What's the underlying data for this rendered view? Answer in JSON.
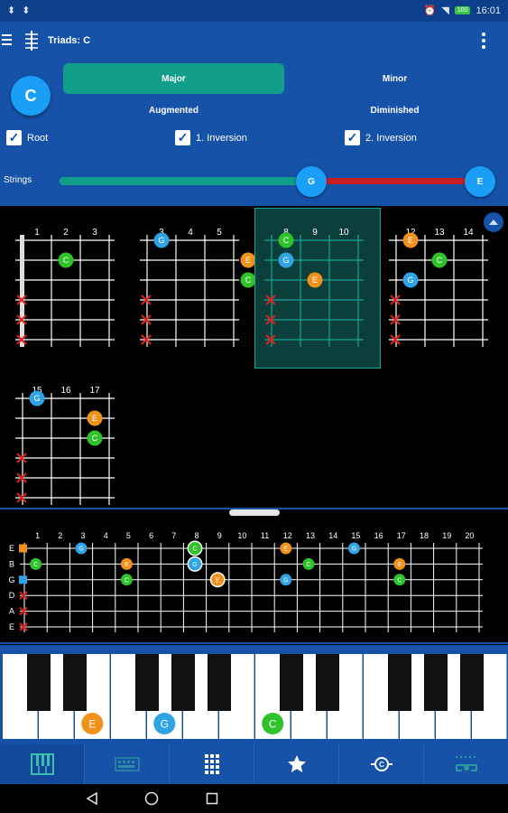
{
  "status": {
    "left_icons": "⬍ ⬍",
    "time": "16:01",
    "battery": "100"
  },
  "app": {
    "title": "Triads: C"
  },
  "root": {
    "note": "C"
  },
  "qualities": {
    "major": "Major",
    "minor": "Minor",
    "augmented": "Augmented",
    "diminished": "Diminished",
    "selected": "Major"
  },
  "inversions": [
    {
      "label": "Root",
      "checked": true
    },
    {
      "label": "1. Inversion",
      "checked": true
    },
    {
      "label": "2. Inversion",
      "checked": true
    }
  ],
  "strings": {
    "label": "Strings",
    "from": "G",
    "to": "E"
  },
  "colors": {
    "C": "#2ec22b",
    "E": "#f0911c",
    "G": "#2ea3e6",
    "accent": "#1552a8",
    "teal": "#119e8b",
    "red": "#c81d24",
    "mute": "#e0201c"
  },
  "chord_diagrams": [
    {
      "frets": [
        "1",
        "2",
        "3"
      ],
      "notes": [
        {
          "s": 1,
          "f": 2,
          "n": "C"
        }
      ],
      "muted": [
        3,
        4,
        5
      ],
      "nut": true,
      "selected": false
    },
    {
      "frets": [
        "3",
        "4",
        "5"
      ],
      "notes": [
        {
          "s": 0,
          "f": 1,
          "n": "G"
        },
        {
          "s": 1,
          "f": 4,
          "n": "E"
        },
        {
          "s": 2,
          "f": 4,
          "n": "C"
        }
      ],
      "muted": [
        3,
        4,
        5
      ],
      "nut": false,
      "selected": false
    },
    {
      "frets": [
        "8",
        "9",
        "10"
      ],
      "notes": [
        {
          "s": 0,
          "f": 1,
          "n": "C"
        },
        {
          "s": 1,
          "f": 1,
          "n": "G"
        },
        {
          "s": 2,
          "f": 2,
          "n": "E"
        }
      ],
      "muted": [
        3,
        4,
        5
      ],
      "nut": false,
      "selected": true
    },
    {
      "frets": [
        "12",
        "13",
        "14"
      ],
      "notes": [
        {
          "s": 0,
          "f": 1,
          "n": "E"
        },
        {
          "s": 1,
          "f": 2,
          "n": "C"
        },
        {
          "s": 2,
          "f": 1,
          "n": "G"
        }
      ],
      "muted": [
        3,
        4,
        5
      ],
      "nut": false,
      "selected": false
    },
    {
      "frets": [
        "15",
        "16",
        "17"
      ],
      "notes": [
        {
          "s": 0,
          "f": 1,
          "n": "G"
        },
        {
          "s": 1,
          "f": 3,
          "n": "E"
        },
        {
          "s": 2,
          "f": 3,
          "n": "C"
        }
      ],
      "muted": [
        3,
        4,
        5
      ],
      "nut": false,
      "selected": false
    }
  ],
  "fretboard": {
    "string_names": [
      "E",
      "B",
      "G",
      "D",
      "A",
      "E"
    ],
    "fret_numbers": [
      "1",
      "2",
      "3",
      "4",
      "5",
      "6",
      "7",
      "8",
      "9",
      "10",
      "11",
      "12",
      "13",
      "14",
      "15",
      "16",
      "17",
      "18",
      "19",
      "20"
    ],
    "notes": [
      {
        "s": 0,
        "f": 3,
        "n": "G",
        "h": false
      },
      {
        "s": 0,
        "f": 8,
        "n": "C",
        "h": true
      },
      {
        "s": 0,
        "f": 12,
        "n": "E",
        "h": false
      },
      {
        "s": 0,
        "f": 15,
        "n": "G",
        "h": false
      },
      {
        "s": 1,
        "f": 1,
        "n": "C",
        "h": false
      },
      {
        "s": 1,
        "f": 5,
        "n": "E",
        "h": false
      },
      {
        "s": 1,
        "f": 8,
        "n": "G",
        "h": true
      },
      {
        "s": 1,
        "f": 13,
        "n": "C",
        "h": false
      },
      {
        "s": 1,
        "f": 17,
        "n": "E",
        "h": false
      },
      {
        "s": 2,
        "f": 5,
        "n": "C",
        "h": false
      },
      {
        "s": 2,
        "f": 9,
        "n": "E",
        "h": true
      },
      {
        "s": 2,
        "f": 12,
        "n": "G",
        "h": false
      },
      {
        "s": 2,
        "f": 17,
        "n": "C",
        "h": false
      }
    ],
    "open_markers": [
      {
        "s": 0,
        "n": "E"
      },
      {
        "s": 2,
        "n": "G"
      }
    ],
    "muted": [
      3,
      4,
      5
    ]
  },
  "keyboard": {
    "labels": [
      {
        "key": 2,
        "n": "E"
      },
      {
        "key": 4,
        "n": "G"
      },
      {
        "key": 7,
        "n": "C"
      }
    ]
  },
  "nav": [
    "piano-icon",
    "keyboard-layout-icon",
    "grid-icon",
    "star-icon",
    "chord-target-icon",
    "strumming-icon"
  ]
}
